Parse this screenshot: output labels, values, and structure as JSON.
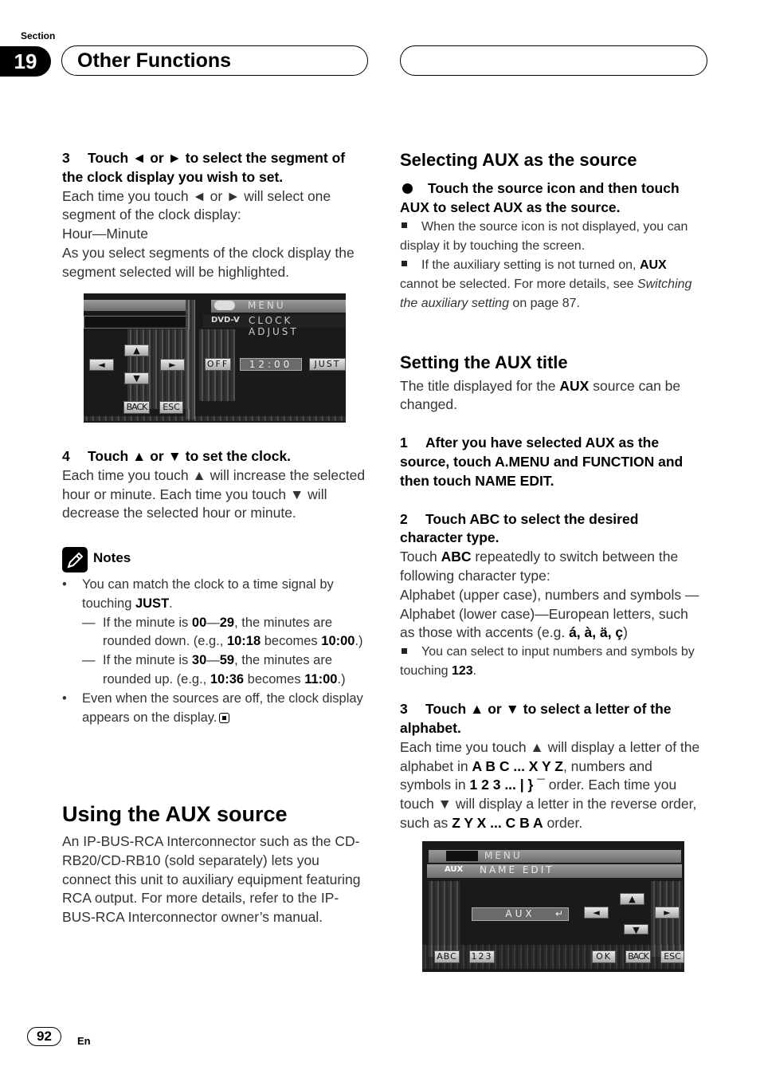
{
  "header": {
    "section_label": "Section",
    "section_number": "19",
    "section_title": "Other Functions"
  },
  "left": {
    "step3": {
      "num": "3",
      "title": "Touch ◄ or ► to select the segment of the clock display you wish to set.",
      "body1": "Each time you touch ◄ or ► will select one segment of the clock display:",
      "body2": "Hour—Minute",
      "body3": "As you select segments of the clock display the segment selected will be highlighted."
    },
    "screen1": {
      "menu": "MENU",
      "source_tag": "DVD-V",
      "title": "CLOCK ADJUST",
      "up": "▲",
      "down": "▼",
      "left": "◄",
      "right": "►",
      "off": "OFF",
      "time": "12:00",
      "just": "JUST",
      "back": "BACK",
      "esc": "ESC"
    },
    "step4": {
      "num": "4",
      "title": "Touch ▲ or ▼ to set the clock.",
      "body": "Each time you touch ▲ will increase the selected hour or minute. Each time you touch ▼ will decrease the selected hour or minute."
    },
    "notes": {
      "label": "Notes",
      "n1_a": "You can match the clock to a time signal by touching ",
      "n1_b": "JUST",
      "n1_c": ".",
      "s1_a": "If the minute is ",
      "s1_b": "00",
      "s1_c": "—",
      "s1_d": "29",
      "s1_e": ", the minutes are rounded down. (e.g., ",
      "s1_f": "10:18",
      "s1_g": " becomes ",
      "s1_h": "10:00",
      "s1_i": ".)",
      "s2_a": "If the minute is ",
      "s2_b": "30",
      "s2_c": "—",
      "s2_d": "59",
      "s2_e": ", the minutes are rounded up. (e.g., ",
      "s2_f": "10:36",
      "s2_g": " becomes ",
      "s2_h": "11:00",
      "s2_i": ".)",
      "n2": "Even when the sources are off, the clock display appears on the display.",
      "dash": "—"
    },
    "aux": {
      "title": "Using the AUX source",
      "body": "An IP-BUS-RCA Interconnector such as the CD-RB20/CD-RB10 (sold separately) lets you connect this unit to auxiliary equipment featuring RCA output. For more details, refer to the IP-BUS-RCA Interconnector owner’s manual."
    }
  },
  "right": {
    "select": {
      "title": "Selecting AUX as the source",
      "bullet": "Touch the source icon and then touch AUX to select AUX as the source.",
      "i1": "When the source icon is not displayed, you can display it by touching the screen.",
      "i2_a": "If the auxiliary setting is not turned on, ",
      "i2_b": "AUX",
      "i2_c": " cannot be selected. For more details, see ",
      "i2_d": "Switching the auxiliary setting",
      "i2_e": " on page 87."
    },
    "title_sec": {
      "title": "Setting the AUX title",
      "body_a": "The title displayed for the ",
      "body_b": "AUX",
      "body_c": " source can be changed.",
      "step1_num": "1",
      "step1": "After you have selected AUX as the source, touch A.MENU and FUNCTION and then touch NAME EDIT.",
      "step2_num": "2",
      "step2": "Touch ABC to select the desired character type.",
      "s2_a": "Touch ",
      "s2_b": "ABC",
      "s2_c": " repeatedly to switch between the following character type:",
      "s2_d": "Alphabet (upper case), numbers and symbols —Alphabet (lower case)—European letters, such as those with accents (e.g. ",
      "s2_e": "á, à, ä, ç",
      "s2_f": ")",
      "s2_i_a": "You can select to input numbers and symbols by touching ",
      "s2_i_b": "123",
      "s2_i_c": ".",
      "step3_num": "3",
      "step3": "Touch ▲ or ▼ to select a letter of the alphabet.",
      "s3_a": "Each time you touch ▲ will display a letter of the alphabet in ",
      "s3_b": "A B C ... X Y Z",
      "s3_c": ", numbers and symbols in ",
      "s3_d": "1 2 3 ... | } ¯",
      "s3_e": " order. Each time you touch ▼ will display a letter in the reverse order, such as ",
      "s3_f": "Z Y X ... C B A",
      "s3_g": " order."
    },
    "screen2": {
      "menu": "MENU",
      "source_tag": "AUX",
      "title": "NAME EDIT",
      "field": "AUX",
      "enter": "↵",
      "up": "▲",
      "down": "▼",
      "left": "◄",
      "right": "►",
      "abc": "ABC",
      "num": "123",
      "ok": "OK",
      "back": "BACK",
      "esc": "ESC"
    }
  },
  "footer": {
    "page_number": "92",
    "language": "En"
  }
}
